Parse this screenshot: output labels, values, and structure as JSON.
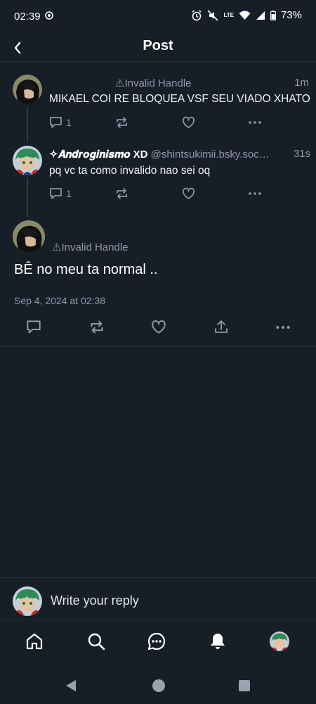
{
  "status_bar": {
    "time": "02:39",
    "battery": "73%",
    "network": "LTE"
  },
  "header": {
    "title": "Post"
  },
  "thread": [
    {
      "handle": "⚠Invalid Handle",
      "time": "1m",
      "text": "MIKAEL COI RE BLOQUEA VSF SEU VIADO XHATO",
      "reply_count": "1"
    },
    {
      "display_name": "✧𝑨𝒏𝒅𝒓𝒐𝒈𝒊𝒏𝒊𝒔𝒎𝒐 XD",
      "handle": "@shintsukimii.bsky.soc…",
      "time": "31s",
      "text": "pq vc ta como invalido nao sei oq",
      "reply_count": "1"
    }
  ],
  "main_post": {
    "handle": "⚠Invalid Handle",
    "text": "BÊ no meu ta normal ..",
    "date": "Sep 4, 2024 at 02:38"
  },
  "reply": {
    "placeholder": "Write your reply"
  },
  "colors": {
    "background": "#161e27",
    "muted": "#8d9aa7",
    "divider": "#222c37"
  }
}
